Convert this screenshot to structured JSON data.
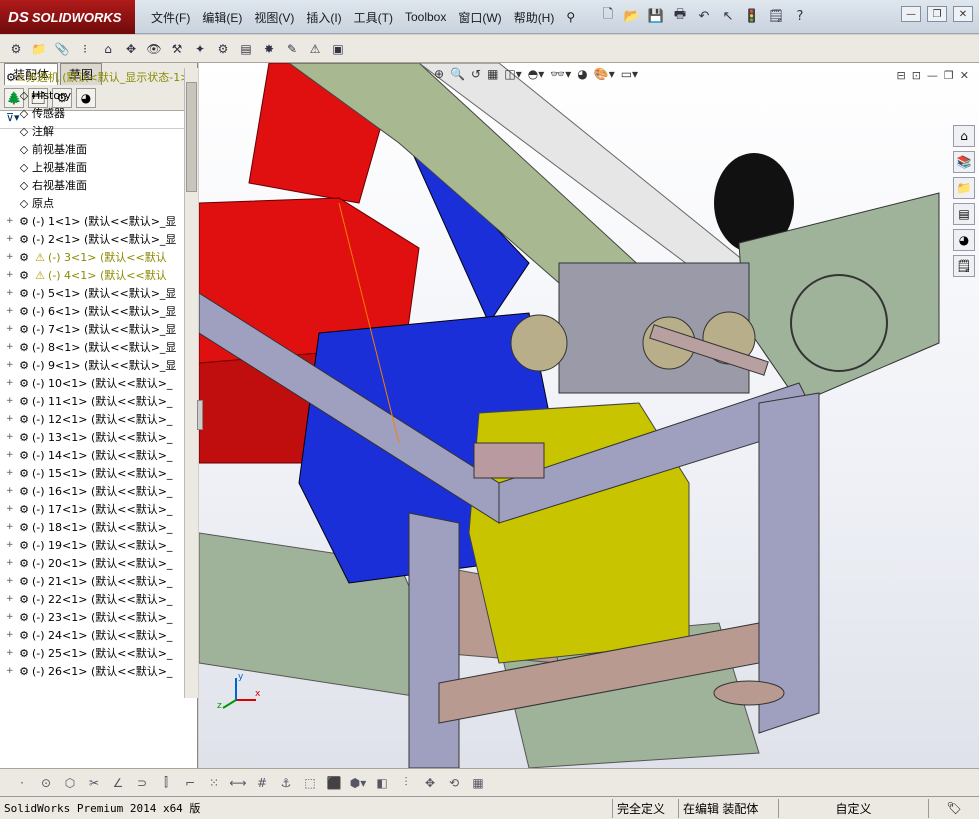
{
  "app": {
    "logo_text": "SOLIDWORKS",
    "logo_mark": "DS"
  },
  "menu": [
    "文件(F)",
    "编辑(E)",
    "视图(V)",
    "插入(I)",
    "工具(T)",
    "Toolbox",
    "窗口(W)",
    "帮助(H)"
  ],
  "feature_manager": {
    "tabs": [
      "装配体",
      "草图"
    ],
    "active_tab": "装配体",
    "top_item": "分选机  (默认<默认_显示状态-1>)",
    "items": [
      {
        "label": "History",
        "icon": "history-icon"
      },
      {
        "label": "传感器",
        "icon": "sensor-icon"
      },
      {
        "label": "注解",
        "icon": "annotation-icon"
      },
      {
        "label": "前视基准面",
        "icon": "plane-icon"
      },
      {
        "label": "上视基准面",
        "icon": "plane-icon"
      },
      {
        "label": "右视基准面",
        "icon": "plane-icon"
      },
      {
        "label": "原点",
        "icon": "origin-icon"
      }
    ],
    "parts": [
      {
        "label": "(-) 1<1> (默认<<默认>_显",
        "warn": false
      },
      {
        "label": "(-) 2<1> (默认<<默认>_显",
        "warn": false
      },
      {
        "label": "(-) 3<1> (默认<<默认",
        "warn": true
      },
      {
        "label": "(-) 4<1> (默认<<默认",
        "warn": true
      },
      {
        "label": "(-) 5<1> (默认<<默认>_显",
        "warn": false
      },
      {
        "label": "(-) 6<1> (默认<<默认>_显",
        "warn": false
      },
      {
        "label": "(-) 7<1> (默认<<默认>_显",
        "warn": false
      },
      {
        "label": "(-) 8<1> (默认<<默认>_显",
        "warn": false
      },
      {
        "label": "(-) 9<1> (默认<<默认>_显",
        "warn": false
      },
      {
        "label": "(-) 10<1> (默认<<默认>_",
        "warn": false
      },
      {
        "label": "(-) 11<1> (默认<<默认>_",
        "warn": false
      },
      {
        "label": "(-) 12<1> (默认<<默认>_",
        "warn": false
      },
      {
        "label": "(-) 13<1> (默认<<默认>_",
        "warn": false
      },
      {
        "label": "(-) 14<1> (默认<<默认>_",
        "warn": false
      },
      {
        "label": "(-) 15<1> (默认<<默认>_",
        "warn": false
      },
      {
        "label": "(-) 16<1> (默认<<默认>_",
        "warn": false
      },
      {
        "label": "(-) 17<1> (默认<<默认>_",
        "warn": false
      },
      {
        "label": "(-) 18<1> (默认<<默认>_",
        "warn": false
      },
      {
        "label": "(-) 19<1> (默认<<默认>_",
        "warn": false
      },
      {
        "label": "(-) 20<1> (默认<<默认>_",
        "warn": false
      },
      {
        "label": "(-) 21<1> (默认<<默认>_",
        "warn": false
      },
      {
        "label": "(-) 22<1> (默认<<默认>_",
        "warn": false
      },
      {
        "label": "(-) 23<1> (默认<<默认>_",
        "warn": false
      },
      {
        "label": "(-) 24<1> (默认<<默认>_",
        "warn": false
      },
      {
        "label": "(-) 25<1> (默认<<默认>_",
        "warn": false
      },
      {
        "label": "(-) 26<1> (默认<<默认>_",
        "warn": false
      }
    ]
  },
  "status": {
    "version": "SolidWorks Premium 2014 x64 版",
    "defined": "完全定义",
    "editing": "在编辑 装配体",
    "units": "自定义"
  },
  "triad_labels": {
    "x": "x",
    "y": "y",
    "z": "z"
  },
  "colors": {
    "red": "#e01010",
    "blue": "#1a2fd8",
    "yellow": "#c8c400",
    "frame": "#9fa0c0",
    "drum": "#a8b890",
    "plate": "#9fb29a"
  }
}
